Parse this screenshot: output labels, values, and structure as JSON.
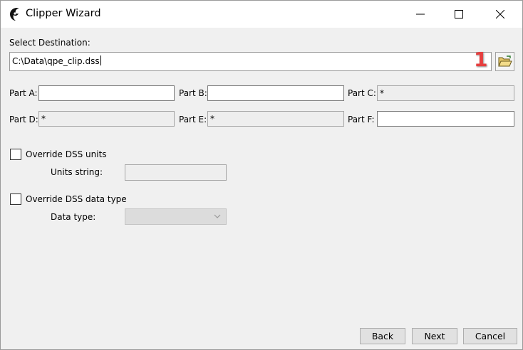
{
  "window": {
    "title": "Clipper Wizard"
  },
  "destination": {
    "label": "Select Destination:",
    "path": "C:\\Data\\qpe_clip.dss",
    "marker": "1"
  },
  "parts": {
    "a": {
      "label": "Part A:",
      "value": ""
    },
    "b": {
      "label": "Part B:",
      "value": ""
    },
    "c": {
      "label": "Part C:",
      "value": "*"
    },
    "d": {
      "label": "Part D:",
      "value": "*"
    },
    "e": {
      "label": "Part E:",
      "value": "*"
    },
    "f": {
      "label": "Part F:",
      "value": ""
    }
  },
  "override_units": {
    "label": "Override DSS units",
    "checked": false,
    "units_label": "Units string:",
    "units_value": ""
  },
  "override_type": {
    "label": "Override DSS data type",
    "checked": false,
    "type_label": "Data type:",
    "type_value": ""
  },
  "buttons": {
    "back": "Back",
    "next": "Next",
    "cancel": "Cancel"
  },
  "icons": {
    "app": "app-logo-icon",
    "browse": "folder-open-icon"
  }
}
